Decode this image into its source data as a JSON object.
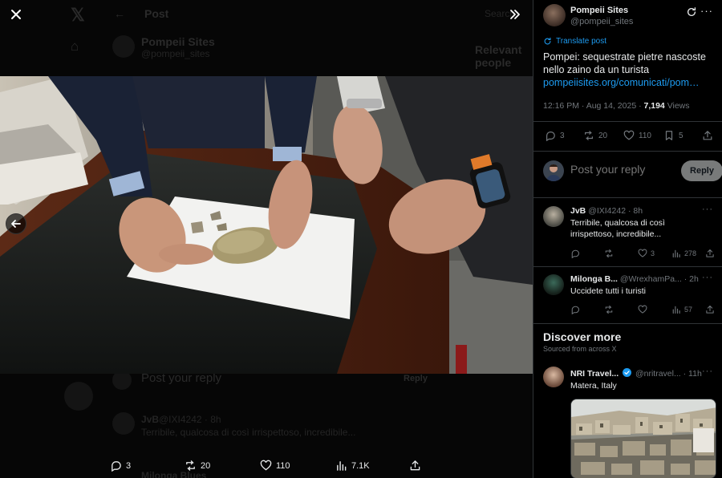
{
  "background_page": {
    "header_title": "Post",
    "author_name": "Pompeii Sites",
    "author_handle": "@pompeii_sites",
    "search_label": "Search",
    "relevant_label": "Relevant people",
    "reply_placeholder": "Post your reply",
    "reply_button": "Reply",
    "reply1_name": "JvB",
    "reply1_handle": "@IXI4242 · 8h",
    "reply1_text": "Terribile, qualcosa di così irrispettoso, incredibile...",
    "reply2_name": "Milonga Blues"
  },
  "viewer": {
    "close_icon": "close-icon",
    "expand_icon": "double-chevron-right-icon",
    "prev_icon": "arrow-left-icon",
    "actions": {
      "replies": "3",
      "reposts": "20",
      "likes": "110",
      "views": "7.1K"
    }
  },
  "post": {
    "author_name": "Pompeii Sites",
    "author_handle": "@pompeii_sites",
    "translate_label": "Translate post",
    "text": "Pompei: sequestrate pietre nascoste nello zaino da un turista",
    "link": "pompeiisites.org/comunicati/pom…",
    "time": "12:16 PM · Aug 14, 2025 · ",
    "views_count": "7,194",
    "views_label": " Views",
    "stats": {
      "replies": "3",
      "reposts": "20",
      "likes": "110",
      "bookmarks": "5"
    }
  },
  "reply_composer": {
    "placeholder": "Post your reply",
    "button": "Reply"
  },
  "replies": [
    {
      "name": "JvB",
      "handle": "@IXI4242 · 8h",
      "text": "Terribile, qualcosa di così irrispettoso, incredibile...",
      "replies": "",
      "reposts": "",
      "likes": "3",
      "views": "278"
    },
    {
      "name": "Milonga B...",
      "handle": "@WrexhamPa... · 2h",
      "text": "Uccidete tutti i turisti",
      "replies": "",
      "reposts": "",
      "likes": "",
      "views": "57"
    }
  ],
  "discover": {
    "title": "Discover more",
    "subtitle": "Sourced from across X",
    "suggestion": {
      "name": "NRI Travel...",
      "handle": "@nritravel... · 11h",
      "text": "Matera, Italy"
    }
  },
  "colors": {
    "accent": "#1d9bf0",
    "muted": "#71767b",
    "text": "#e7e9ea",
    "border": "#2f3336"
  }
}
